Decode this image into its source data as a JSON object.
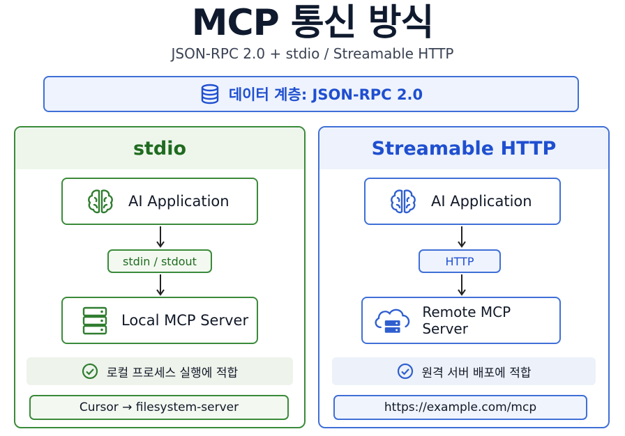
{
  "header": {
    "title": "MCP 통신 방식",
    "subtitle": "JSON-RPC 2.0 + stdio / Streamable HTTP"
  },
  "data_layer": {
    "label": "데이터 계층: JSON-RPC 2.0",
    "icon": "database-icon"
  },
  "stdio": {
    "title": "stdio",
    "client": {
      "label": "AI Application",
      "icon": "brain-icon"
    },
    "transport": "stdin / stdout",
    "server": {
      "label": "Local MCP Server",
      "icon": "server-icon"
    },
    "note": "로컬 프로세스 실행에 적합",
    "example": "Cursor → filesystem-server",
    "color": "#3a8a3a"
  },
  "http": {
    "title": "Streamable HTTP",
    "client": {
      "label": "AI Application",
      "icon": "brain-icon"
    },
    "transport": "HTTP",
    "server": {
      "label": "Remote MCP Server",
      "icon": "cloud-server-icon"
    },
    "note": "원격 서버 배포에 적합",
    "example": "https://example.com/mcp",
    "color": "#3f6fd6"
  }
}
